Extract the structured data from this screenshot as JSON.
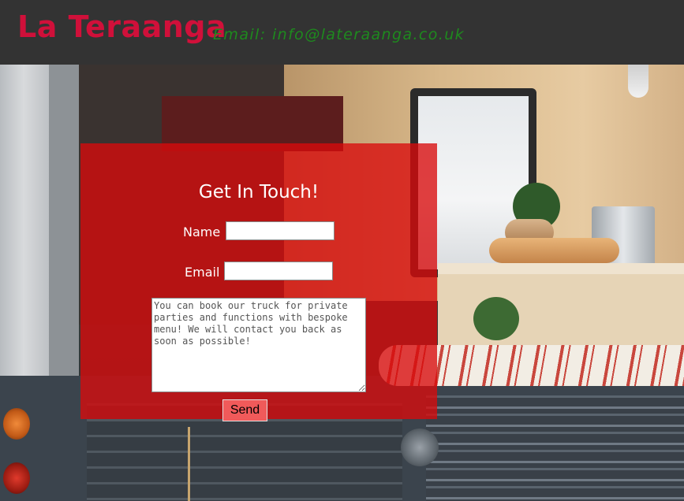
{
  "header": {
    "brand": "La Teraanga",
    "email": "Email: info@lateraanga.co.uk"
  },
  "contact": {
    "title": "Get In Touch!",
    "name_label": "Name",
    "email_label": "Email",
    "name_value": "",
    "email_value": "",
    "message_placeholder": "You can book our truck for private parties and functions with bespoke menu! We will contact you back as soon as possible!",
    "send_label": "Send"
  },
  "colors": {
    "header_bg": "#333333",
    "brand": "#d0103a",
    "email": "#1e8a1e",
    "panel": "#d80a0c",
    "send_button": "#f05a5a"
  }
}
